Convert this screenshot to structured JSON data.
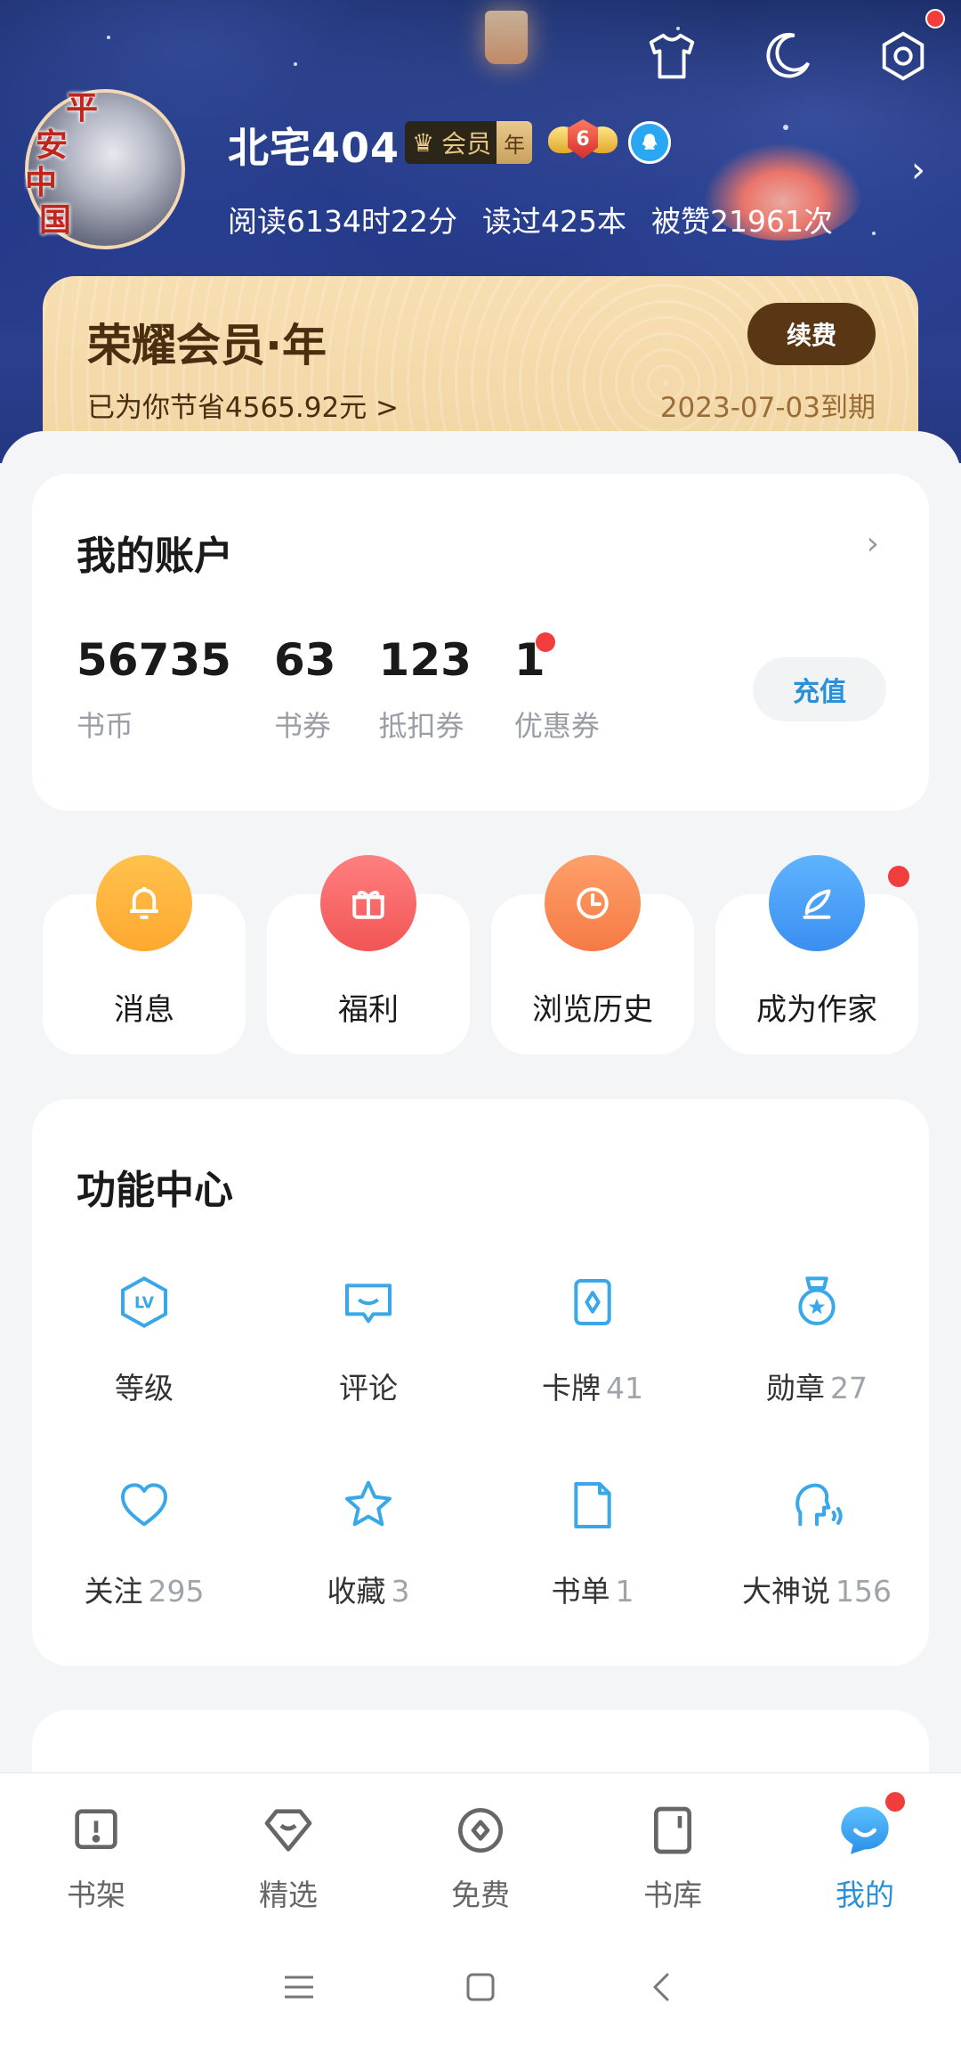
{
  "profile": {
    "avatar_seal_text": "平安中国",
    "username": "北宅404",
    "vip_badge": {
      "label": "会员",
      "period": "年"
    },
    "level": "6",
    "stats": {
      "reading": "阅读6134时22分",
      "books": "读过425本",
      "likes": "被赞21961次"
    },
    "arrow": "›"
  },
  "top_icons": [
    "shirt-icon",
    "moon-icon",
    "settings-icon"
  ],
  "vip_card": {
    "title": "荣耀会员·年",
    "renew_label": "续费",
    "savings": "已为你节省4565.92元 >",
    "expiry": "2023-07-03到期"
  },
  "account": {
    "title": "我的账户",
    "arrow": "›",
    "items": [
      {
        "value": "56735",
        "label": "书币"
      },
      {
        "value": "63",
        "label": "书券"
      },
      {
        "value": "123",
        "label": "抵扣券"
      },
      {
        "value": "1",
        "label": "优惠券"
      }
    ],
    "recharge_label": "充值"
  },
  "quick_actions": [
    {
      "label": "消息",
      "icon": "bell-icon",
      "color": "#ffb13d"
    },
    {
      "label": "福利",
      "icon": "gift-icon",
      "color": "#ff6b6b"
    },
    {
      "label": "浏览历史",
      "icon": "clock-icon",
      "color": "#ff8f5a"
    },
    {
      "label": "成为作家",
      "icon": "quill-icon",
      "color": "#3a9df0"
    }
  ],
  "features": {
    "title": "功能中心",
    "items": [
      {
        "label": "等级",
        "count": "",
        "icon": "level-icon"
      },
      {
        "label": "评论",
        "count": "",
        "icon": "comment-icon"
      },
      {
        "label": "卡牌",
        "count": "41",
        "icon": "card-icon"
      },
      {
        "label": "勋章",
        "count": "27",
        "icon": "medal-icon"
      },
      {
        "label": "关注",
        "count": "295",
        "icon": "heart-icon"
      },
      {
        "label": "收藏",
        "count": "3",
        "icon": "star-icon"
      },
      {
        "label": "书单",
        "count": "1",
        "icon": "booklist-icon"
      },
      {
        "label": "大神说",
        "count": "156",
        "icon": "speaker-icon"
      }
    ]
  },
  "bottom_nav": [
    {
      "label": "书架",
      "icon": "bookshelf-icon",
      "active": false
    },
    {
      "label": "精选",
      "icon": "featured-icon",
      "active": false
    },
    {
      "label": "免费",
      "icon": "free-icon",
      "active": false
    },
    {
      "label": "书库",
      "icon": "library-icon",
      "active": false
    },
    {
      "label": "我的",
      "icon": "me-icon",
      "active": true
    }
  ],
  "colors": {
    "accent": "#2a91d9",
    "feature_icon": "#3aa8e8",
    "badge_red": "#f23d3d",
    "vip_brown": "#5a3714"
  }
}
